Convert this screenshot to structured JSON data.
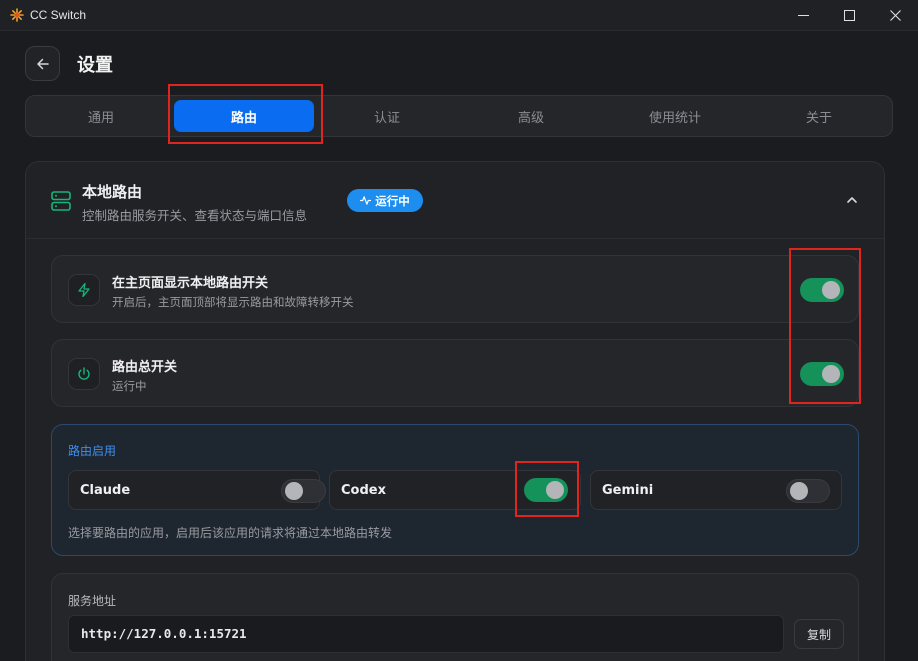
{
  "window": {
    "title": "CC Switch"
  },
  "header": {
    "title": "设置"
  },
  "tabs": [
    {
      "label": "通用",
      "active": false
    },
    {
      "label": "路由",
      "active": true
    },
    {
      "label": "认证",
      "active": false
    },
    {
      "label": "高级",
      "active": false
    },
    {
      "label": "使用统计",
      "active": false
    },
    {
      "label": "关于",
      "active": false
    }
  ],
  "local_router": {
    "title": "本地路由",
    "subtitle": "控制路由服务开关、查看状态与端口信息",
    "status_badge": "运行中",
    "show_toggle_row": {
      "title": "在主页面显示本地路由开关",
      "subtitle": "开启后，主页面顶部将显示路由和故障转移开关",
      "enabled": true
    },
    "master_switch_row": {
      "title": "路由总开关",
      "subtitle": "运行中",
      "enabled": true
    },
    "apps": {
      "label": "路由启用",
      "items": [
        {
          "name": "Claude",
          "enabled": false
        },
        {
          "name": "Codex",
          "enabled": true
        },
        {
          "name": "Gemini",
          "enabled": false
        }
      ],
      "hint": "选择要路由的应用，启用后该应用的请求将通过本地路由转发"
    },
    "service_address": {
      "label": "服务地址",
      "value": "http://127.0.0.1:15721",
      "copy_label": "复制"
    }
  },
  "colors": {
    "accent": "#0a6cf0",
    "badge": "#1d8ef0",
    "switch_on": "#14925a",
    "highlight": "#e0241e",
    "apps_label": "#3d8ff0"
  }
}
